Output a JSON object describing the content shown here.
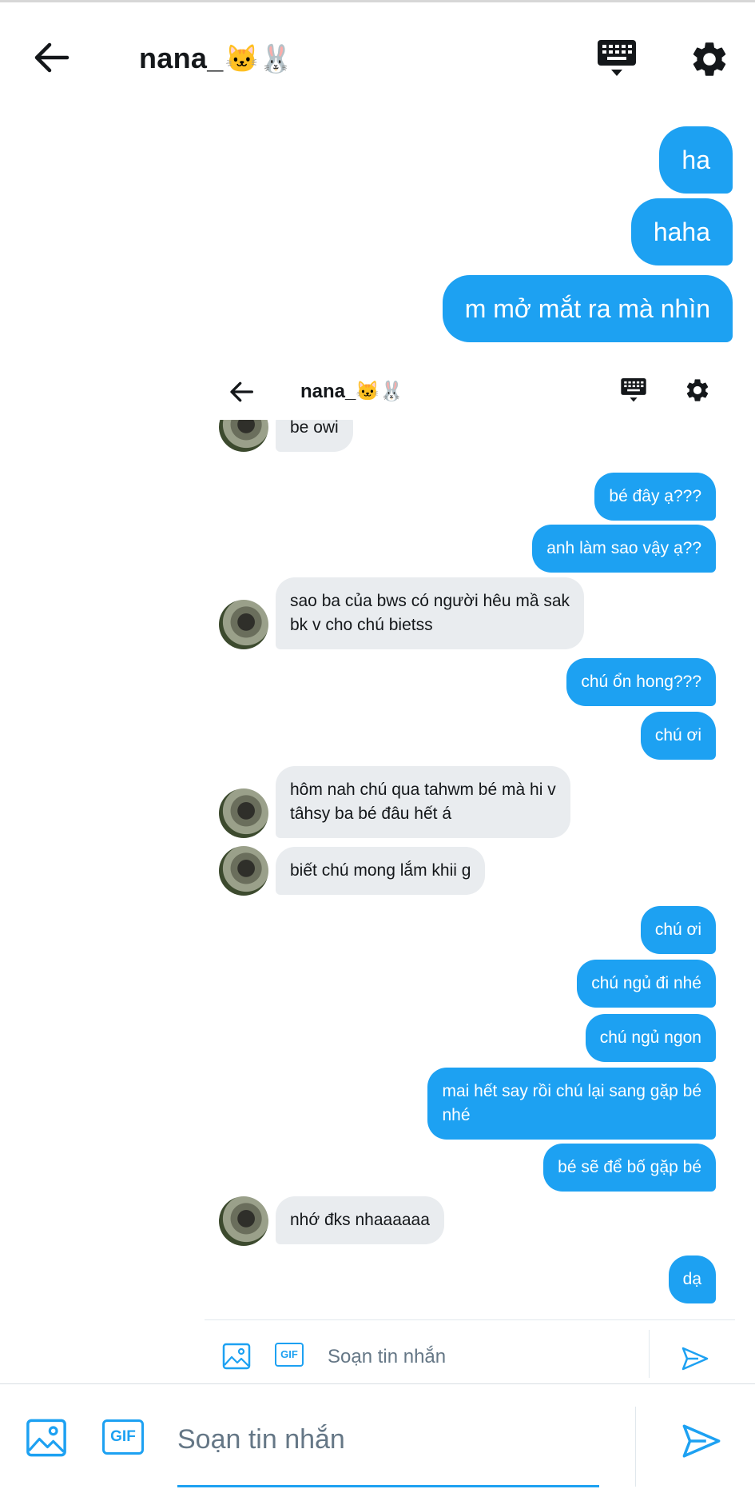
{
  "header": {
    "title": "nana_",
    "title_emoji": "🐱🐰"
  },
  "outer_messages": [
    "ha",
    "haha",
    "m mở mắt ra mà nhìn"
  ],
  "inner": {
    "header": {
      "title": "nana_",
      "title_emoji": "🐱🐰"
    },
    "messages": [
      {
        "side": "left",
        "text": "be owi"
      },
      {
        "side": "right",
        "text": "bé đây ạ???"
      },
      {
        "side": "right",
        "text": "anh làm sao vậy ạ??"
      },
      {
        "side": "left",
        "text": "sao ba của bws có người hêu mầ sak\nbk v cho chú bietss"
      },
      {
        "side": "right",
        "text": "chú ổn hong???"
      },
      {
        "side": "right",
        "text": "chú ơi"
      },
      {
        "side": "left",
        "text": "hôm nah chú qua tahwm bé mà hi v\ntâhsy ba bé đâu hết á"
      },
      {
        "side": "left",
        "text": "biết chú mong lắm khii g"
      },
      {
        "side": "right",
        "text": "chú ơi"
      },
      {
        "side": "right",
        "text": "chú ngủ đi nhé"
      },
      {
        "side": "right",
        "text": "chú ngủ ngon"
      },
      {
        "side": "right",
        "text": "mai hết say rồi chú lại sang gặp bé\nnhé"
      },
      {
        "side": "right",
        "text": "bé sẽ để bố gặp bé"
      },
      {
        "side": "left",
        "text": "nhớ đks nhaaaaaa"
      },
      {
        "side": "right",
        "text": "dạ"
      }
    ],
    "composer": {
      "gif_label": "GIF",
      "placeholder": "Soạn tin nhắn"
    }
  },
  "composer": {
    "gif_label": "GIF",
    "placeholder": "Soạn tin nhắn"
  },
  "colors": {
    "accent": "#1da1f2",
    "incoming": "#e9ecef",
    "text": "#14171a",
    "muted": "#657786"
  },
  "icons": [
    "back-arrow-icon",
    "keyboard-icon",
    "gear-icon",
    "image-icon",
    "gif-icon",
    "send-icon"
  ]
}
